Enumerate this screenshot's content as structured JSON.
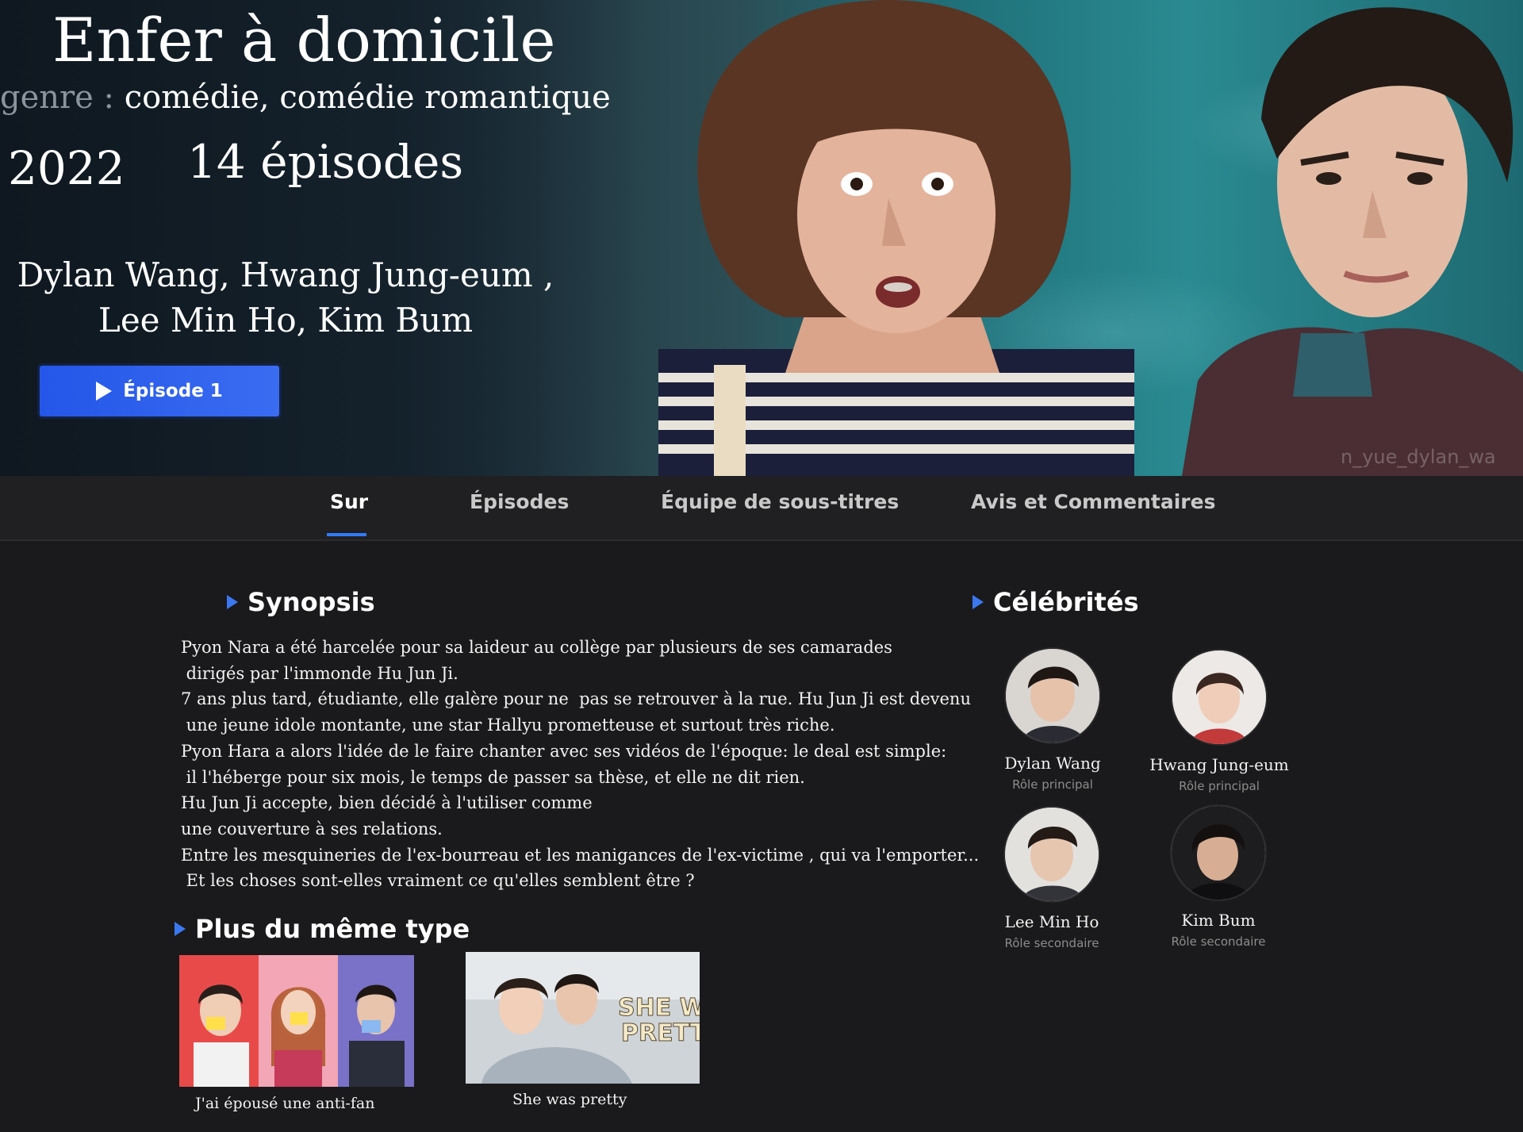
{
  "hero": {
    "title": "Enfer à domicile",
    "genre_label": "genre :",
    "genre_value": "comédie, comédie romantique",
    "year": "2022",
    "episodes": "14 épisodes",
    "cast_line1": "Dylan Wang, Hwang Jung-eum ,",
    "cast_line2": "Lee Min Ho, Kim Bum",
    "play_label": "Épisode 1",
    "watermark": "n_yue_dylan_wa"
  },
  "tabs": [
    {
      "label": "Sur",
      "active": true
    },
    {
      "label": "Épisodes",
      "active": false
    },
    {
      "label": "Équipe de sous-titres",
      "active": false
    },
    {
      "label": "Avis et Commentaires",
      "active": false
    }
  ],
  "synopsis": {
    "heading": "Synopsis",
    "lines": [
      "Pyon Nara a été harcelée pour sa laideur au collège par plusieurs de ses camarades",
      " dirigés par l'immonde Hu Jun Ji.",
      "7 ans plus tard, étudiante, elle galère pour ne  pas se retrouver à la rue. Hu Jun Ji est devenu",
      " une jeune idole montante, une star Hallyu prometteuse et surtout très riche.",
      "Pyon Hara a alors l'idée de le faire chanter avec ses vidéos de l'époque: le deal est simple:",
      " il l'héberge pour six mois, le temps de passer sa thèse, et elle ne dit rien.",
      "Hu Jun Ji accepte, bien décidé à l'utiliser comme",
      "une couverture à ses relations.",
      "Entre les mesquineries de l'ex-bourreau et les manigances de l'ex-victime , qui va l'emporter...",
      " Et les choses sont-elles vraiment ce qu'elles semblent être ?"
    ]
  },
  "celebrities": {
    "heading": "Célébrités",
    "items": [
      {
        "name": "Dylan Wang",
        "role": "Rôle principal"
      },
      {
        "name": "Hwang Jung-eum",
        "role": "Rôle principal"
      },
      {
        "name": "Lee Min Ho",
        "role": "Rôle secondaire"
      },
      {
        "name": "Kim Bum",
        "role": "Rôle secondaire"
      }
    ]
  },
  "similar": {
    "heading": "Plus du même type",
    "items": [
      {
        "title": "J'ai épousé une anti-fan"
      },
      {
        "title": "She was pretty",
        "poster_text_1": "SHE WAS",
        "poster_text_2": "PRETTY"
      }
    ]
  },
  "colors": {
    "accent": "#2f7bff",
    "play_button": "#2a5ef0",
    "background": "#1a1a1c"
  }
}
